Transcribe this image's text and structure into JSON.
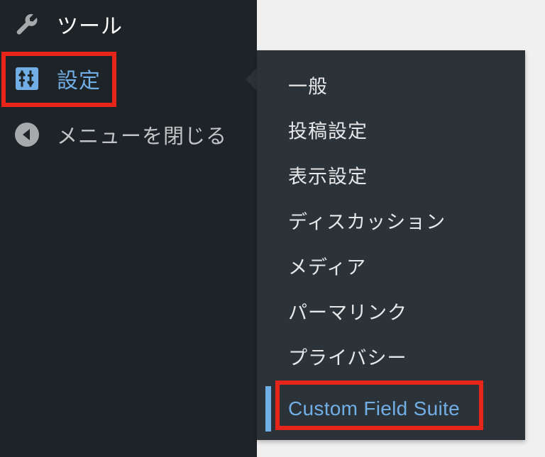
{
  "sidebar": {
    "items": [
      {
        "id": "tools",
        "label": "ツール",
        "icon": "wrench-icon"
      },
      {
        "id": "settings",
        "label": "設定",
        "icon": "settings-sliders-icon"
      },
      {
        "id": "collapse",
        "label": "メニューを閉じる",
        "icon": "collapse-arrow-icon"
      }
    ]
  },
  "settings_submenu": {
    "items": [
      {
        "label": "一般"
      },
      {
        "label": "投稿設定"
      },
      {
        "label": "表示設定"
      },
      {
        "label": "ディスカッション"
      },
      {
        "label": "メディア"
      },
      {
        "label": "パーマリンク"
      },
      {
        "label": "プライバシー"
      },
      {
        "label": "Custom Field Suite",
        "current": true
      }
    ]
  },
  "colors": {
    "sidebar_bg": "#1d2327",
    "flyout_bg": "#2c3338",
    "accent": "#72aee6",
    "highlight": "#e8251a",
    "page_bg": "#f0f0f1"
  }
}
